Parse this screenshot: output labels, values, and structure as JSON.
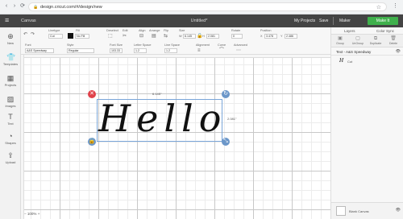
{
  "browser": {
    "url": "design.cricut.com/#/design/new"
  },
  "app": {
    "canvas_label": "Canvas",
    "doc_title": "Untitled*",
    "my_projects": "My Projects",
    "save": "Save",
    "machine": "Maker",
    "make_it": "Make It"
  },
  "toolbar": {
    "linetype_label": "Linetype",
    "linetype_value": "Cut",
    "fill_label": "Fill",
    "fill_value": "No Fill",
    "deselect": "Deselect",
    "edit": "Edit",
    "align": "Align",
    "arrange": "Arrange",
    "flip": "Flip",
    "size": "Size",
    "w_label": "W",
    "w_value": "6.145",
    "h_label": "H",
    "h_value": "2.081",
    "rotate": "Rotate",
    "rotate_value": "0",
    "position": "Position",
    "x_label": "X",
    "x_value": "3.478",
    "y_label": "Y",
    "y_value": "2.486",
    "font_label": "Font",
    "font_value": "A&S Speedway",
    "style_label": "Style",
    "style_value": "Regular",
    "font_size_label": "Font Size",
    "font_size_value": "103.33",
    "letter_space_label": "Letter Space",
    "letter_space_value": "1.2",
    "line_space_label": "Line Space",
    "line_space_value": "1.2",
    "alignment_label": "Alignment",
    "curve_label": "Curve",
    "advanced_label": "Advanced"
  },
  "sidebar": {
    "items": [
      {
        "label": "New"
      },
      {
        "label": "Templates"
      },
      {
        "label": "Projects"
      },
      {
        "label": "Images"
      },
      {
        "label": "Text"
      },
      {
        "label": "Shapes"
      },
      {
        "label": "Upload"
      }
    ]
  },
  "canvas": {
    "text": "Hello",
    "width_readout": "6.145\"",
    "height_readout": "2.081\""
  },
  "layers": {
    "tab_layers": "Layers",
    "tab_color_sync": "Color Sync",
    "actions": [
      "Group",
      "UnGroup",
      "Duplicate",
      "Delete"
    ],
    "group_title": "Text - A&S Speedway",
    "item_thumb": "H",
    "item_op": "Cut",
    "blank_canvas": "Blank Canvas"
  },
  "zoom": {
    "value": "100%"
  }
}
